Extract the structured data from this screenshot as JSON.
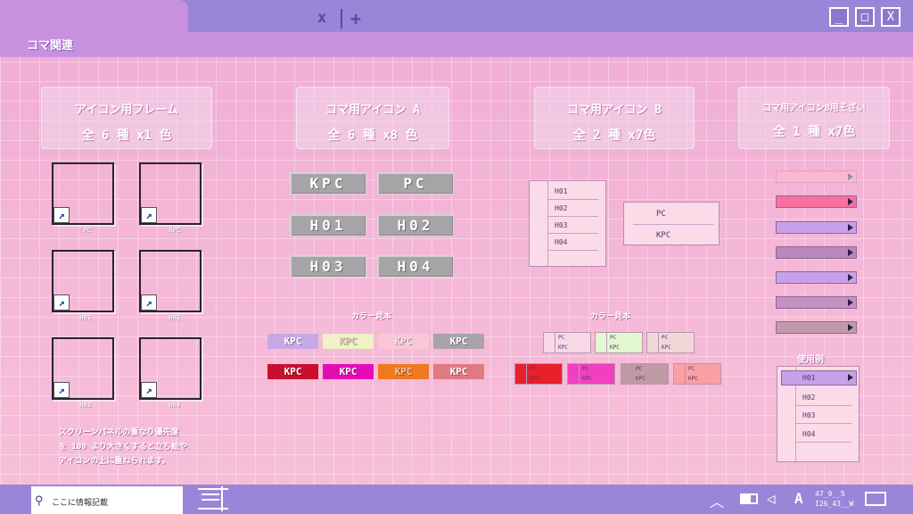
{
  "window": {
    "tab_close": "x",
    "tab_add": "+",
    "header_title": "コマ関連",
    "controls": {
      "minimize": "_",
      "maximize": "□",
      "close": "X"
    }
  },
  "panels": {
    "frame": {
      "line1": "アイコン用フレーム",
      "line2": "全 6 種 x1 色"
    },
    "icon_a": {
      "line1": "コマ用アイコン A",
      "line2": "全 6 種 x8 色"
    },
    "icon_b": {
      "line1": "コマ用アイコン B",
      "line2": "全 2 種 x7色"
    },
    "icon_b_sub": {
      "line1": "コマ用アイコンB用そざい",
      "line2": "全 1 種 x7色"
    }
  },
  "frames": [
    {
      "label": "PC"
    },
    {
      "label": "KPC"
    },
    {
      "label": "H01"
    },
    {
      "label": "H02"
    },
    {
      "label": "H03"
    },
    {
      "label": "H04"
    }
  ],
  "frame_icon_glyph": "↗",
  "icon_a": {
    "badges": [
      "KPC",
      "PC",
      "H01",
      "H02",
      "H03",
      "H04"
    ],
    "sample_title": "カラー見本",
    "swatch_label": "KPC",
    "swatches_row1": [
      "#c8a8e4",
      "#eef2c4",
      "#f8c8d4",
      "#a7a4a8"
    ],
    "swatches_row2": [
      "#c8102e",
      "#e60cb4",
      "#f07820",
      "#e07a80"
    ]
  },
  "icon_b": {
    "list": [
      "H01",
      "H02",
      "H03",
      "H04"
    ],
    "list2": [
      "PC",
      "KPC"
    ],
    "sample_title": "カラー見本",
    "mini_a": "PC",
    "mini_b": "KPC",
    "mini_row1": [
      "#f8d8e4",
      "#e4f8d0",
      "#f0d8d8"
    ],
    "mini_row2": [
      "#e8202c",
      "#f040c0",
      "#c09aa4",
      "#f8a0a4"
    ]
  },
  "icon_b_sub": {
    "tag_colors": [
      "#f8b8d0",
      "#f870a0",
      "#c8a0e8",
      "#b888b8",
      "#c8a0e8",
      "#c890c0",
      "#c09aa8"
    ],
    "usage_title": "使用例",
    "usage_list": [
      "H01",
      "H02",
      "H03",
      "H04"
    ]
  },
  "annotation": {
    "line1": "スクリーンパネルの重なり優先度",
    "line2": "を 100 より大きくすると立ち絵や",
    "line3": "アイコンの上に重ねられます。"
  },
  "taskbar": {
    "search_placeholder": "ここに情報記載",
    "clock_line1": "47_9__5",
    "clock_line2": "126_43__W",
    "ime_label": "A"
  }
}
